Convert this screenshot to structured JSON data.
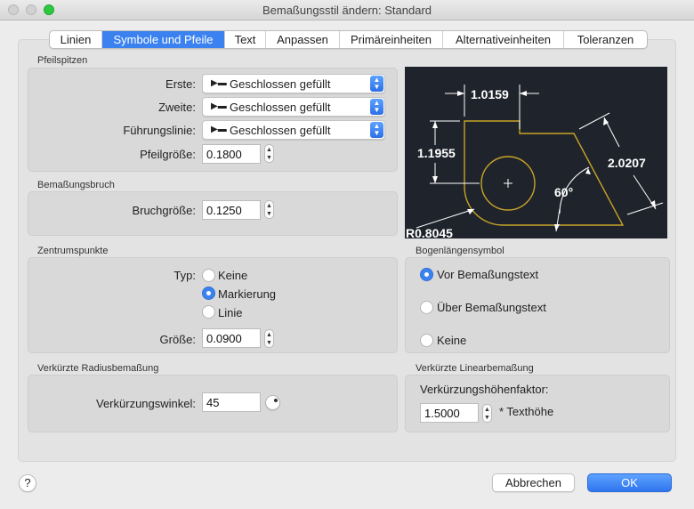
{
  "window": {
    "title": "Bemaßungsstil ändern: Standard"
  },
  "tabs": [
    {
      "label": "Linien"
    },
    {
      "label": "Symbole und Pfeile"
    },
    {
      "label": "Text"
    },
    {
      "label": "Anpassen"
    },
    {
      "label": "Primäreinheiten"
    },
    {
      "label": "Alternativeinheiten"
    },
    {
      "label": "Toleranzen"
    }
  ],
  "active_tab": "Symbole und Pfeile",
  "arrowheads": {
    "title": "Pfeilspitzen",
    "first_label": "Erste:",
    "first_value": "Geschlossen gefüllt",
    "second_label": "Zweite:",
    "second_value": "Geschlossen gefüllt",
    "leader_label": "Führungslinie:",
    "leader_value": "Geschlossen gefüllt",
    "size_label": "Pfeilgröße:",
    "size_value": "0.1800"
  },
  "dimbreak": {
    "title": "Bemaßungsbruch",
    "size_label": "Bruchgröße:",
    "size_value": "0.1250"
  },
  "center": {
    "title": "Zentrumspunkte",
    "type_label": "Typ:",
    "options": [
      "Keine",
      "Markierung",
      "Linie"
    ],
    "selected": "Markierung",
    "size_label": "Größe:",
    "size_value": "0.0900"
  },
  "radius_jog": {
    "title": "Verkürzte Radiusbemaßung",
    "angle_label": "Verkürzungswinkel:",
    "angle_value": "45"
  },
  "arc_symbol": {
    "title": "Bogenlängensymbol",
    "options": [
      "Vor Bemaßungstext",
      "Über Bemaßungstext",
      "Keine"
    ],
    "selected": "Vor Bemaßungstext"
  },
  "linear_jog": {
    "title": "Verkürzte Linearbemaßung",
    "factor_label": "Verkürzungshöhenfaktor:",
    "factor_value": "1.5000",
    "suffix": "* Texthöhe"
  },
  "preview": {
    "dim_top": "1.0159",
    "dim_left": "1.1955",
    "dim_right": "2.0207",
    "angle": "60°",
    "radius": "R0.8045"
  },
  "footer": {
    "help": "?",
    "cancel": "Abbrechen",
    "ok": "OK"
  },
  "colors": {
    "accent": "#3b82f0",
    "preview_bg": "#1f232b",
    "preview_outline": "#c8a428"
  }
}
